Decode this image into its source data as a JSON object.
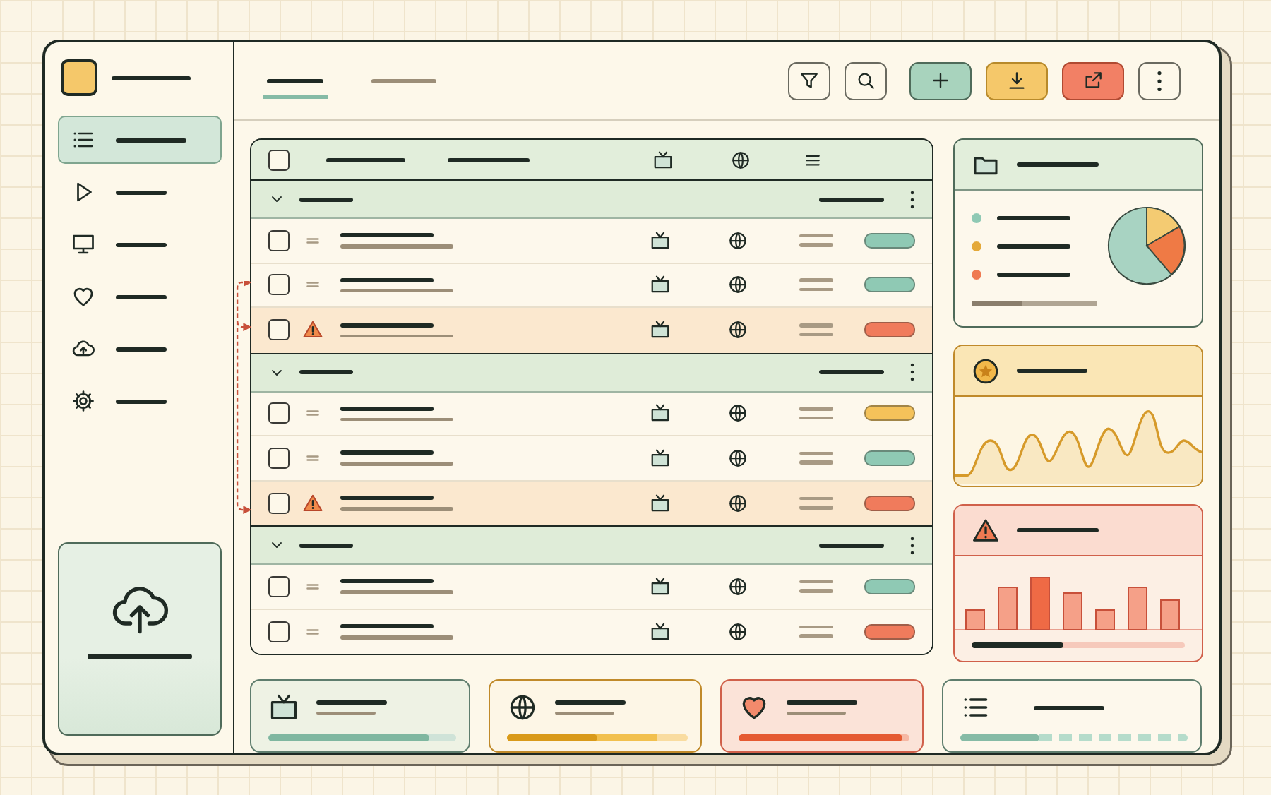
{
  "sidebar": {
    "items": [
      {
        "kind": "list",
        "selected": true
      },
      {
        "kind": "play",
        "selected": false
      },
      {
        "kind": "monitor",
        "selected": false
      },
      {
        "kind": "heart",
        "selected": false
      },
      {
        "kind": "cloud",
        "selected": false
      },
      {
        "kind": "gear",
        "selected": false
      }
    ]
  },
  "tabs": [
    {
      "selected": true
    },
    {
      "selected": false
    }
  ],
  "toolbar": [
    {
      "kind": "filter"
    },
    {
      "kind": "search"
    },
    {
      "kind": "add"
    },
    {
      "kind": "download"
    },
    {
      "kind": "share"
    },
    {
      "kind": "more"
    }
  ],
  "table": {
    "header": {
      "checked": false
    },
    "groups": [
      {
        "expanded": true,
        "rows": [
          {
            "checked": false,
            "warning": false,
            "color": "#8fc9b4"
          },
          {
            "checked": false,
            "warning": false,
            "color": "#8fc9b4"
          },
          {
            "checked": false,
            "warning": true,
            "color": "#f07b5c"
          }
        ]
      },
      {
        "expanded": true,
        "rows": [
          {
            "checked": false,
            "warning": false,
            "color": "#f4c25a"
          },
          {
            "checked": false,
            "warning": false,
            "color": "#8fc9b4"
          },
          {
            "checked": false,
            "warning": true,
            "color": "#f07b5c"
          }
        ]
      },
      {
        "expanded": true,
        "rows": [
          {
            "checked": false,
            "warning": false,
            "color": "#8fc9b4"
          },
          {
            "checked": false,
            "warning": false,
            "color": "#f07b5c"
          }
        ]
      }
    ]
  },
  "summary_card": {
    "legend": [
      {
        "color": "#8fc9b4"
      },
      {
        "color": "#e4a93a"
      },
      {
        "color": "#ef7a52"
      }
    ],
    "level": 0.4
  },
  "alerts_card": {
    "level": 0.43
  },
  "stat_cards": [
    {
      "kind": "tv",
      "level": 0.86
    },
    {
      "kind": "globe",
      "level": 0.5
    },
    {
      "kind": "heart",
      "level": 0.96
    },
    {
      "kind": "list",
      "level": 0.35
    }
  ]
}
